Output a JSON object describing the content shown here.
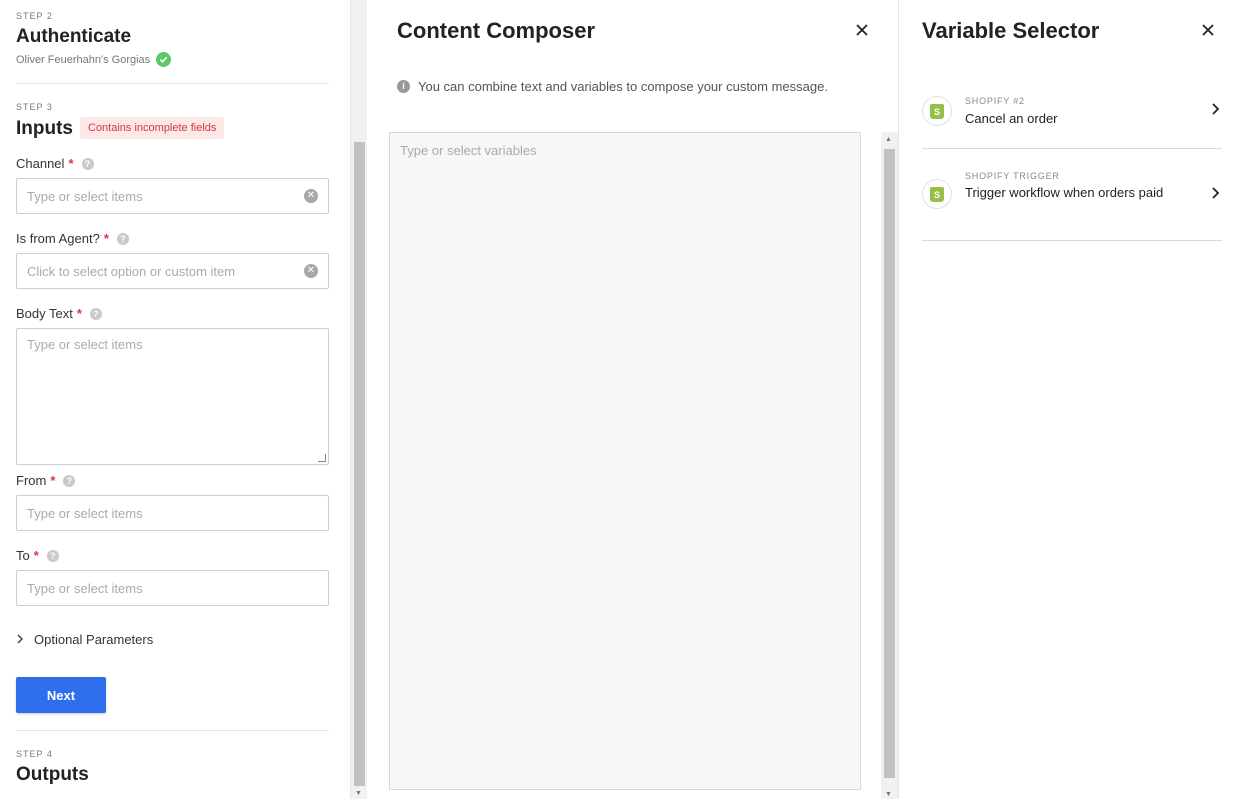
{
  "steps": {
    "authenticate": {
      "step_label": "STEP 2",
      "title": "Authenticate",
      "account": "Oliver Feuerhahn's Gorgias"
    },
    "inputs": {
      "step_label": "STEP 3",
      "title": "Inputs",
      "badge": "Contains incomplete fields"
    },
    "outputs": {
      "step_label": "STEP 4",
      "title": "Outputs"
    }
  },
  "fields": {
    "channel": {
      "label": "Channel",
      "placeholder": "Type or select items"
    },
    "is_from_agent": {
      "label": "Is from Agent?",
      "placeholder": "Click to select option or custom item"
    },
    "body_text": {
      "label": "Body Text",
      "placeholder": "Type or select items"
    },
    "from": {
      "label": "From",
      "placeholder": "Type or select items"
    },
    "to": {
      "label": "To",
      "placeholder": "Type or select items"
    },
    "required_marker": "*",
    "help_glyph": "?"
  },
  "optional_parameters": "Optional Parameters",
  "next_button": "Next",
  "composer": {
    "title": "Content Composer",
    "info": "You can combine text and variables to compose your custom message.",
    "placeholder": "Type or select variables"
  },
  "selector": {
    "title": "Variable Selector",
    "items": [
      {
        "kicker": "SHOPIFY #2",
        "label": "Cancel an order"
      },
      {
        "kicker": "SHOPIFY TRIGGER",
        "label": "Trigger workflow when orders paid"
      }
    ]
  },
  "colors": {
    "primary": "#2f6fed",
    "success": "#5cc86a",
    "error": "#d9363e",
    "shopify": "#95bf47"
  }
}
